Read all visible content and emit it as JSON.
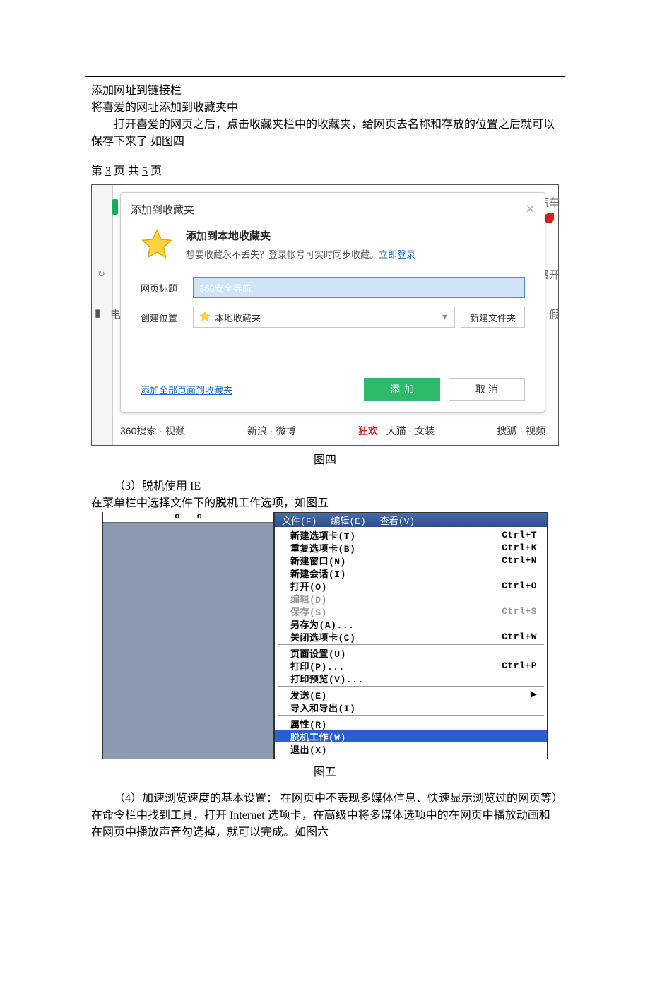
{
  "doc": {
    "line1": "添加网址到链接栏",
    "line2": "将喜爱的网址添加到收藏夹中",
    "line3": "打开喜爱的网页之后，点击收藏夹栏中的收藏夹，给网页去名称和存放的位置之后就可以保存下来了   如图四",
    "pageinfo_prefix": "第 ",
    "pageinfo_cur": "3",
    "pageinfo_mid": " 页 共 ",
    "pageinfo_total": "5",
    "pageinfo_suffix": " 页",
    "fig4_caption": "图四",
    "section3_title": "（3）脱机使用 IE",
    "section3_text": "在菜单栏中选择文件下的脱机工作选项，如图五",
    "fig5_caption": "图五",
    "section4_line1": "（4）加速浏览速度的基本设置：  在网页中不表现多媒体信息、快速显示浏览过的网页等）",
    "section4_line2": "在命令栏中找到工具，打开 Internet 选项卡，在高级中将多媒体选项中的在网页中播放动画和在网页中播放声音勾选掉，就可以完成。如图六"
  },
  "dialog": {
    "title": "添加到收藏夹",
    "promo_title": "添加到本地收藏夹",
    "promo_desc": "想要收藏永不丢失？登录帐号可实时同步收藏。",
    "promo_link": "立即登录",
    "label_title": "网页标题",
    "input_value": "360安全导航",
    "label_location": "创建位置",
    "location_value": "本地收藏夹",
    "new_folder": "新建文件夹",
    "add_all": "添加全部页面到收藏夹",
    "btn_add": "添加",
    "btn_cancel": "取消",
    "side_text_1": "汽车",
    "side_text_2": "展开",
    "side_text_3": "假"
  },
  "bottom_links": {
    "l1a": "360搜索",
    "l1b": "视频",
    "l2a": "新浪",
    "l2b": "微博",
    "l3_red": "狂欢",
    "l3a": "大猫",
    "l3b": "女装",
    "l4a": "搜狐",
    "l4b": "视频"
  },
  "fig5": {
    "dot_o": "o",
    "dot_c": "c",
    "menubar": {
      "file": "文件(F)",
      "edit": "编辑(E)",
      "view": "查看(V)"
    },
    "items": [
      {
        "label": "新建选项卡(T)",
        "shortcut": "Ctrl+T"
      },
      {
        "label": "重复选项卡(B)",
        "shortcut": "Ctrl+K"
      },
      {
        "label": "新建窗口(N)",
        "shortcut": "Ctrl+N"
      },
      {
        "label": "新建会话(I)",
        "shortcut": ""
      },
      {
        "label": "打开(O)",
        "shortcut": "Ctrl+O"
      },
      {
        "label": "编辑(D)",
        "shortcut": "",
        "disabled": true
      },
      {
        "label": "保存(S)",
        "shortcut": "Ctrl+S",
        "disabled": true
      },
      {
        "label": "另存为(A)...",
        "shortcut": ""
      },
      {
        "label": "关闭选项卡(C)",
        "shortcut": "Ctrl+W"
      },
      {
        "sep": true
      },
      {
        "label": "页面设置(U)",
        "shortcut": ""
      },
      {
        "label": "打印(P)...",
        "shortcut": "Ctrl+P"
      },
      {
        "label": "打印预览(V)...",
        "shortcut": ""
      },
      {
        "sep": true
      },
      {
        "label": "发送(E)",
        "shortcut": "",
        "arrow": true
      },
      {
        "label": "导入和导出(I)",
        "shortcut": ""
      },
      {
        "sep": true
      },
      {
        "label": "属性(R)",
        "shortcut": ""
      },
      {
        "label": "脱机工作(W)",
        "shortcut": "",
        "highlighted": true
      },
      {
        "label": "退出(X)",
        "shortcut": ""
      }
    ]
  }
}
